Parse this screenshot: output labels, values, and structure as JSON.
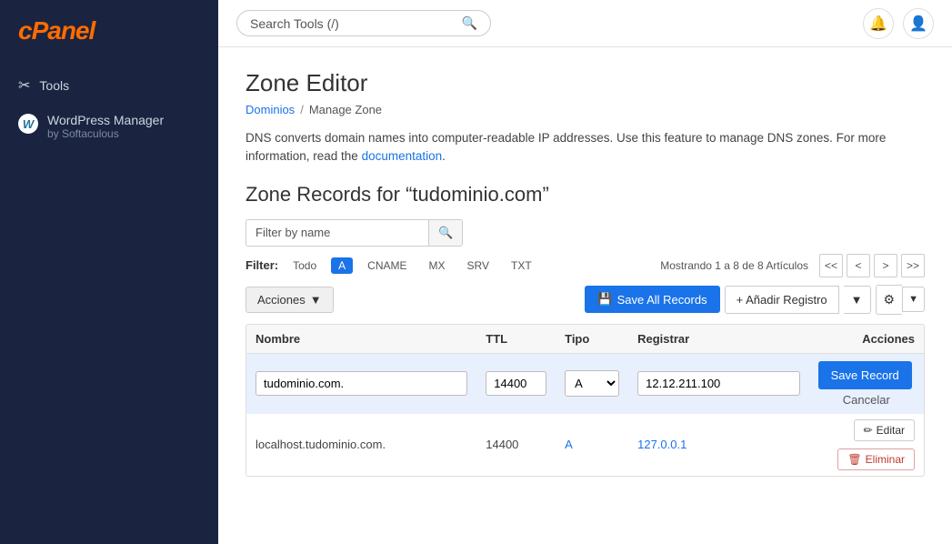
{
  "sidebar": {
    "logo": "cPanel",
    "logo_c": "c",
    "logo_rest": "Panel",
    "items": [
      {
        "id": "tools",
        "label": "Tools",
        "icon": "✂"
      },
      {
        "id": "wordpress-manager",
        "label": "WordPress Manager",
        "sub": "by Softaculous",
        "icon": "W"
      }
    ]
  },
  "header": {
    "search_placeholder": "Search Tools (/)",
    "search_icon": "🔍",
    "notification_icon": "🔔",
    "user_icon": "👤"
  },
  "page": {
    "title": "Zone Editor",
    "breadcrumb": {
      "parent": "Dominios",
      "separator": "/",
      "current": "Manage Zone"
    },
    "description": "DNS converts domain names into computer-readable IP addresses. Use this feature to manage DNS zones. For more information, read the",
    "description_link": "documentation",
    "description_end": ".",
    "section_title": "Zone Records for “tudominio.com”"
  },
  "filter": {
    "placeholder": "Filter by name",
    "label": "Filter:",
    "tags": [
      {
        "id": "all",
        "label": "Todo"
      },
      {
        "id": "a",
        "label": "A",
        "active": true
      },
      {
        "id": "cname",
        "label": "CNAME"
      },
      {
        "id": "mx",
        "label": "MX"
      },
      {
        "id": "srv",
        "label": "SRV"
      },
      {
        "id": "txt",
        "label": "TXT"
      }
    ],
    "pagination_info": "Mostrando 1 a 8 de 8 Artículos",
    "page_first": "<<",
    "page_prev": "<",
    "page_next": ">",
    "page_last": ">>"
  },
  "toolbar": {
    "acciones_label": "Acciones",
    "save_all_label": "Save All Records",
    "save_icon": "💾",
    "add_label": "+ Añadir Registro",
    "gear_icon": "⚙",
    "dropdown_icon": "▼"
  },
  "table": {
    "columns": [
      "Nombre",
      "TTL",
      "Tipo",
      "Registrar",
      "Acciones"
    ],
    "edit_row": {
      "nombre": "tudominio.com.",
      "ttl": "14400",
      "tipo": "A",
      "registrar": "12.12.211.100",
      "save_label": "Save Record",
      "cancel_label": "Cancelar"
    },
    "rows": [
      {
        "nombre": "localhost.tudominio.com.",
        "ttl": "14400",
        "tipo": "A",
        "registrar": "127.0.0.1",
        "edit_label": "✏ Editar",
        "delete_label": "🗑 Eliminar"
      }
    ]
  }
}
